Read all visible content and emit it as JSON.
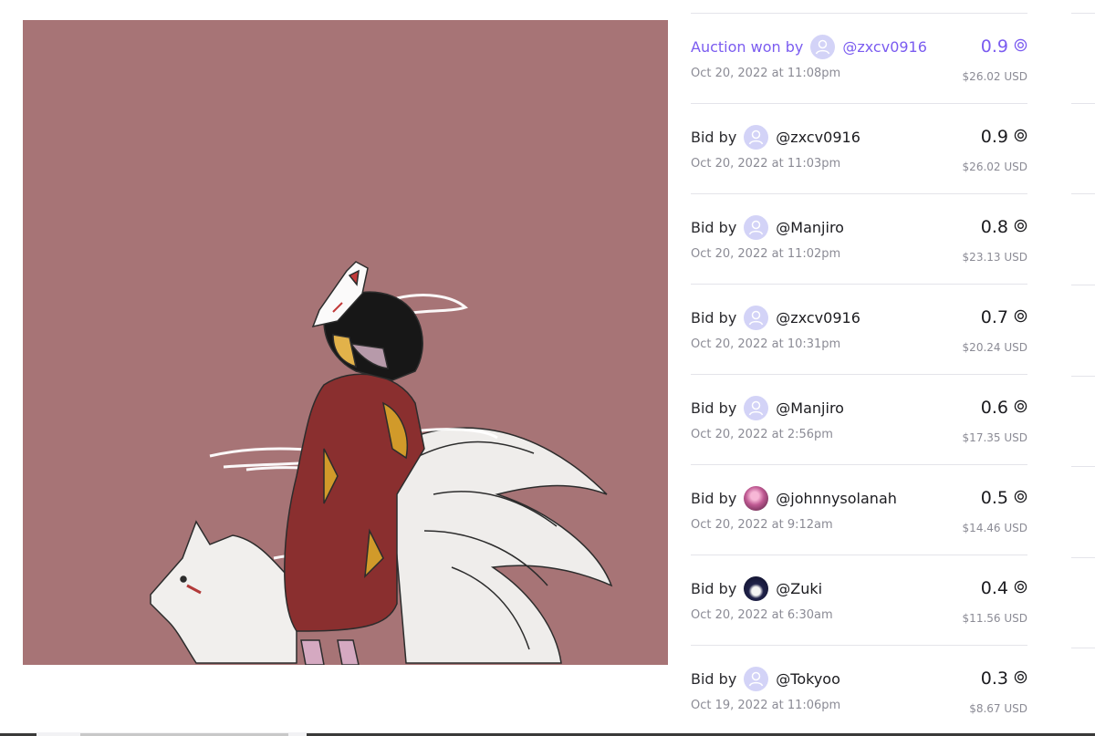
{
  "artwork": {
    "name": "fox-mask-artwork"
  },
  "bids": [
    {
      "label": "Auction won by",
      "handle": "@zxcv0916",
      "date": "Oct 20, 2022 at 11:08pm",
      "amount": "0.9",
      "usd": "$26.02 USD",
      "avatar": "default",
      "winner": true
    },
    {
      "label": "Bid by",
      "handle": "@zxcv0916",
      "date": "Oct 20, 2022 at 11:03pm",
      "amount": "0.9",
      "usd": "$26.02 USD",
      "avatar": "default",
      "winner": false
    },
    {
      "label": "Bid by",
      "handle": "@Manjiro",
      "date": "Oct 20, 2022 at 11:02pm",
      "amount": "0.8",
      "usd": "$23.13 USD",
      "avatar": "default",
      "winner": false
    },
    {
      "label": "Bid by",
      "handle": "@zxcv0916",
      "date": "Oct 20, 2022 at 10:31pm",
      "amount": "0.7",
      "usd": "$20.24 USD",
      "avatar": "default",
      "winner": false
    },
    {
      "label": "Bid by",
      "handle": "@Manjiro",
      "date": "Oct 20, 2022 at 2:56pm",
      "amount": "0.6",
      "usd": "$17.35 USD",
      "avatar": "default",
      "winner": false
    },
    {
      "label": "Bid by",
      "handle": "@johnnysolanah",
      "date": "Oct 20, 2022 at 9:12am",
      "amount": "0.5",
      "usd": "$14.46 USD",
      "avatar": "pink",
      "winner": false
    },
    {
      "label": "Bid by",
      "handle": "@Zuki",
      "date": "Oct 20, 2022 at 6:30am",
      "amount": "0.4",
      "usd": "$11.56 USD",
      "avatar": "dark",
      "winner": false
    },
    {
      "label": "Bid by",
      "handle": "@Tokyoo",
      "date": "Oct 19, 2022 at 11:06pm",
      "amount": "0.3",
      "usd": "$8.67 USD",
      "avatar": "default",
      "winner": false
    }
  ],
  "colors": {
    "accent": "#7b5cf0",
    "muted": "#8b8b95",
    "avatar_bg": "#d3d3f7",
    "artwork_bg": "#a77476"
  },
  "icons": {
    "currency": "solana-coin-icon",
    "avatar": "user-placeholder-icon"
  }
}
